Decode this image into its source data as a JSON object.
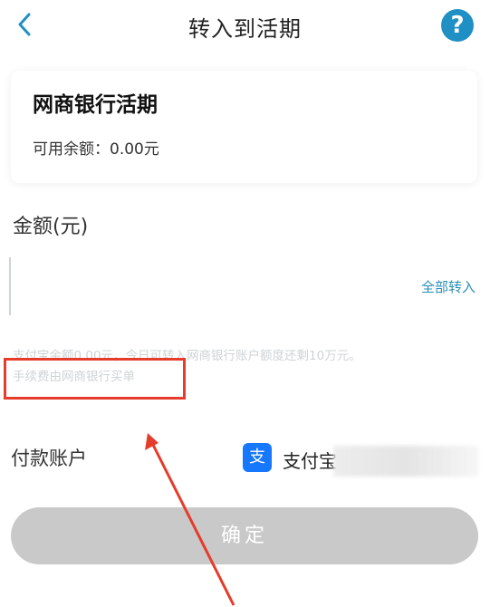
{
  "header": {
    "title": "转入到活期",
    "back_icon": "chevron-left-icon",
    "help_icon": "question-icon",
    "help_glyph": "?",
    "accent": "#1f8fc4"
  },
  "account_card": {
    "name": "网商银行活期",
    "balance": "可用余额：0.00元"
  },
  "amount": {
    "label": "金额(元)",
    "value": "",
    "all_in": "全部转入"
  },
  "note": {
    "line1": "支付宝余额0.00元，今日可转入网商银行账户额度还剩10万元。",
    "line2": "手续费由网商银行买单"
  },
  "payment": {
    "label": "付款账户",
    "method": "支付宝",
    "method_icon": "alipay-icon",
    "icon_glyph": "支"
  },
  "confirm": {
    "label": "确定"
  },
  "annotation": {
    "highlight_color": "#e53c2c"
  }
}
